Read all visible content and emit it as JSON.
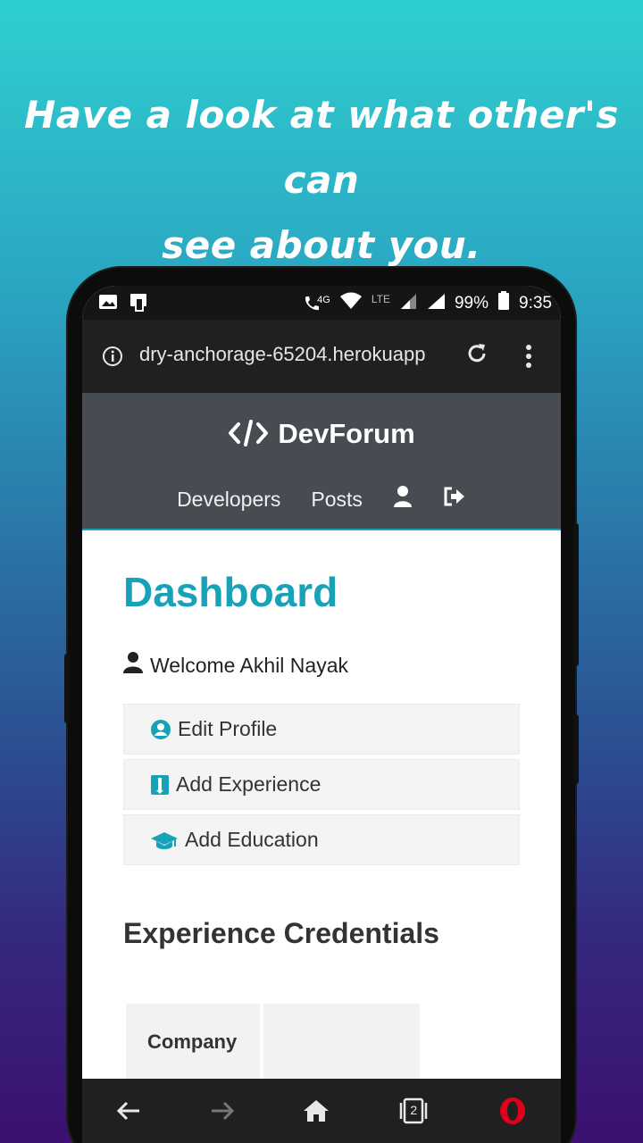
{
  "promo": {
    "line1": "Have a look at what other's can",
    "line2": "see about you."
  },
  "status_bar": {
    "network": "4G",
    "lte": "LTE",
    "battery": "99%",
    "time": "9:35"
  },
  "browser": {
    "url": "dry-anchorage-65204.herokuapp"
  },
  "navbar": {
    "brand": "DevForum",
    "links": [
      "Developers",
      "Posts"
    ]
  },
  "dashboard": {
    "title": "Dashboard",
    "welcome": "Welcome Akhil Nayak",
    "buttons": [
      "Edit Profile",
      "Add Experience",
      "Add Education"
    ],
    "experience_heading": "Experience Credentials",
    "table_headers": [
      "Company",
      ""
    ]
  },
  "bottom_nav": {
    "tabs_count": "2"
  },
  "colors": {
    "accent": "#17a2b8",
    "navbar": "#474c53",
    "opera_red": "#e0001b"
  }
}
